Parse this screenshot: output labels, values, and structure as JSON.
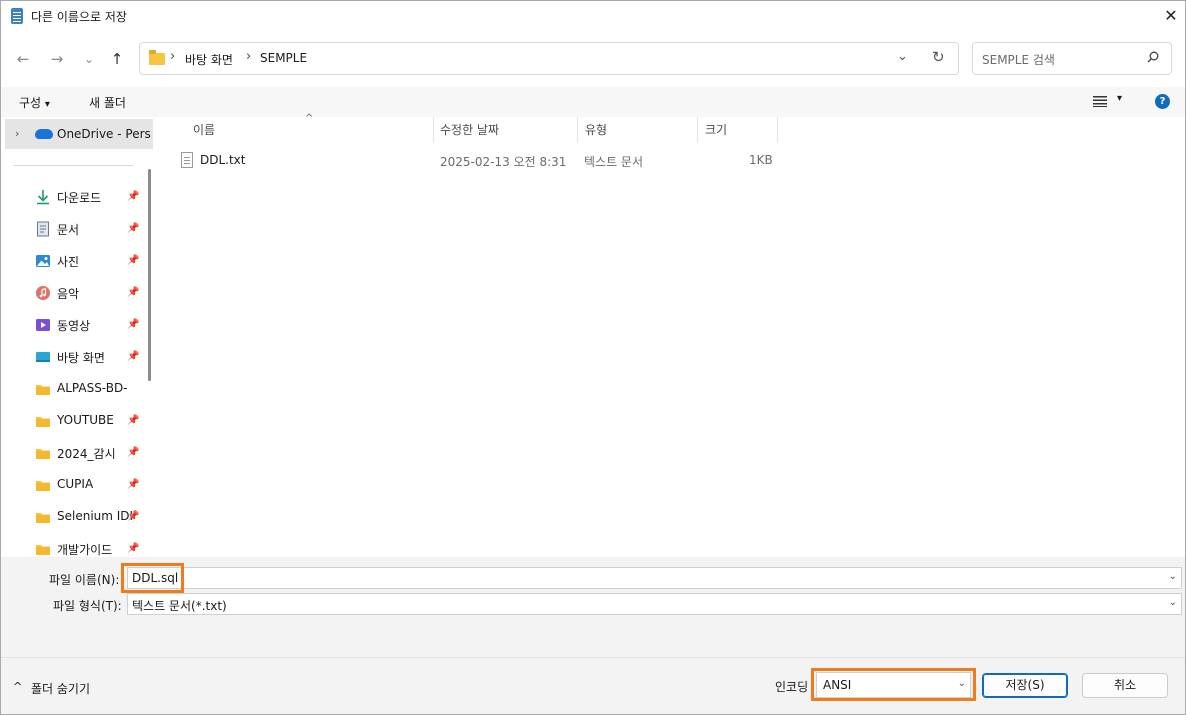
{
  "window": {
    "title": "다른 이름으로 저장",
    "close_glyph": "✕"
  },
  "nav": {
    "back": "←",
    "forward": "→",
    "recent": "⌄",
    "up": "↑"
  },
  "address": {
    "crumbs": [
      "바탕 화면",
      "SEMPLE"
    ],
    "sep": "›",
    "dropdown": "⌄",
    "refresh": "↻"
  },
  "search": {
    "placeholder": "SEMPLE 검색"
  },
  "toolbar": {
    "organize": "구성",
    "organize_arrow": "▾",
    "new_folder": "새 폴더",
    "view_arrow": "▾",
    "help": "?"
  },
  "sidebar": {
    "onedrive": "OneDrive - Pers",
    "onedrive_chevron": "›",
    "pin_glyph": "📌",
    "items": [
      {
        "label": "다운로드",
        "icon": "download-icon"
      },
      {
        "label": "문서",
        "icon": "document-icon"
      },
      {
        "label": "사진",
        "icon": "picture-icon"
      },
      {
        "label": "음악",
        "icon": "music-icon"
      },
      {
        "label": "동영상",
        "icon": "video-icon"
      },
      {
        "label": "바탕 화면",
        "icon": "desktop-icon"
      },
      {
        "label": "ALPASS-BD-",
        "icon": "folder-icon"
      },
      {
        "label": "YOUTUBE",
        "icon": "folder-icon"
      },
      {
        "label": "2024_감시",
        "icon": "folder-icon"
      },
      {
        "label": "CUPIA",
        "icon": "folder-icon"
      },
      {
        "label": "Selenium IDI",
        "icon": "folder-icon"
      },
      {
        "label": "개발가이드",
        "icon": "folder-icon"
      }
    ]
  },
  "columns": {
    "name": "이름",
    "modified": "수정한 날짜",
    "type": "유형",
    "size": "크기",
    "sort_glyph": "^"
  },
  "files": [
    {
      "name": "DDL.txt",
      "modified": "2025-02-13 오전 8:31",
      "type": "텍스트 문서",
      "size": "1KB"
    }
  ],
  "form": {
    "filename_label": "파일 이름(N):",
    "filename_value": "DDL.sql",
    "filetype_label": "파일 형식(T):",
    "filetype_value": "텍스트 문서(*.txt)",
    "combo_arrow": "⌄"
  },
  "footer": {
    "hide_chevron": "^",
    "hide_folders": "폴더 숨기기",
    "encoding_label": "인코딩",
    "encoding_value": "ANSI",
    "save": "저장(S)",
    "cancel": "취소"
  },
  "colors": {
    "accent": "#0f6cbd",
    "highlight": "#f07a1c",
    "folder": "#f8c542"
  }
}
